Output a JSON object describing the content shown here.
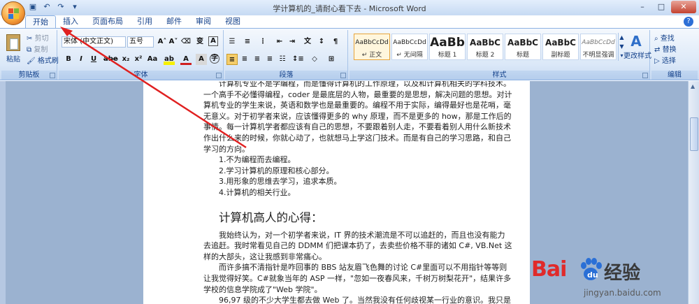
{
  "window": {
    "title": "学计算机的_请耐心看下去 - Microsoft Word",
    "controls": [
      "–",
      "□",
      "✕"
    ]
  },
  "tabs": [
    "开始",
    "插入",
    "页面布局",
    "引用",
    "邮件",
    "审阅",
    "视图"
  ],
  "ribbon": {
    "clipboard": {
      "label": "剪贴板",
      "paste": "粘贴",
      "cut": "剪切",
      "copy": "复制",
      "format_painter": "格式刷"
    },
    "font": {
      "label": "字体",
      "font_name": "宋体 (中文正文)",
      "font_size": "五号"
    },
    "paragraph": {
      "label": "段落"
    },
    "styles": {
      "label": "样式",
      "items": [
        {
          "sample": "AaBbCcDd",
          "name": "↵ 正文"
        },
        {
          "sample": "AaBbCcDd",
          "name": "↵ 无间隔"
        },
        {
          "sample": "AaBb",
          "name": "标题 1"
        },
        {
          "sample": "AaBbC",
          "name": "标题 2"
        },
        {
          "sample": "AaBbC",
          "name": "标题"
        },
        {
          "sample": "AaBbC",
          "name": "副标题"
        },
        {
          "sample": "AaBbCcDd",
          "name": "不明显强调"
        }
      ],
      "change_styles": "更改样式"
    },
    "editing": {
      "label": "编辑",
      "find": "查找",
      "replace": "替换",
      "select": "选择"
    }
  },
  "document": {
    "intro_lines": [
      "计算机专业不是学编程，而是懂得计算机的工作原理，以及和计算机相关的学科技术。",
      "一个高手不必懂得编程，coder 是最底层的人物，最重要的是思想，解决问题的思想。对计",
      "算机专业的学生来说，英语和数学也是最重要的。编程不用于实际，编得最好也是花哨，毫",
      "无意义。对于初学者来说，应该懂得更多的 why 原理，而不是更多的 how，那是工作后的",
      "事情。每一计算机学者都应该有自己的思想，不要跟着别人走，不要看着别人用什么新技术",
      "作出什么来的时候，你就心动了，也就想马上学这门技术。而是有自己的学习思路，和自己",
      "学习的方向。"
    ],
    "list": [
      "1.不为编程而去编程。",
      "2.学习计算机的原理和核心部分。",
      "3.用形象的思维去学习，追求本质。",
      "4.计算机的相关行业。"
    ],
    "heading": "计算机高人的心得：",
    "para2_lines": [
      "我始终认为，对一个初学者来说，IT 界的技术潮流是不可以追赶的，而且也没有能力",
      "去追赶。我时常看见自己的 DDMM 们把课本扔了，去卖些价格不菲的诸如 C#, VB.Net 这",
      "样的大部头，这让我感到非常痛心。"
    ],
    "para3_lines": [
      "而许多搞不清指针是咋回事的 BBS 站友眉飞色舞的讨论 C#里面可以不用指针等等则",
      "让我觉得好笑。C#就象当年的 ASP 一样，\"忽如一夜春风来，千树万树梨花开\"，结果许多",
      "学校的信息学院成了\"Web 学院\"。"
    ],
    "para4_lines": [
      "96,97 级的不少大学生都去做 Web 了。当然我没有任何歧视某一行业的意识。我只是"
    ]
  },
  "watermark": {
    "brand": "Bai",
    "suffix": "经验",
    "url": "jingyan.baidu.com"
  },
  "colors": {
    "ribbon_text": "#15428b",
    "annotation_red": "#e02020",
    "page_bg": "#9bb2d0"
  }
}
